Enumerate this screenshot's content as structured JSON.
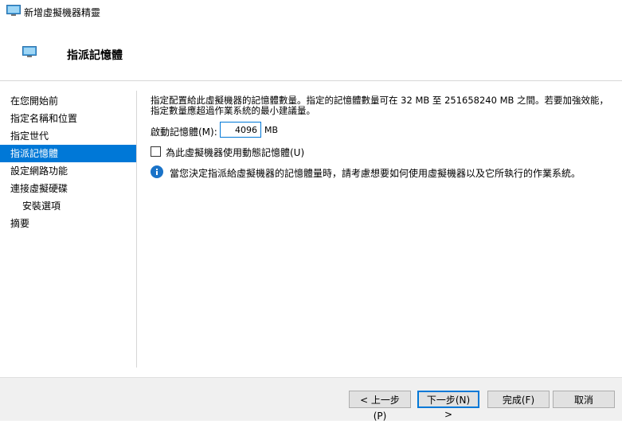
{
  "window": {
    "title": "新增虛擬機器精靈"
  },
  "header": {
    "heading": "指派記憶體"
  },
  "sidebar": {
    "items": [
      {
        "label": "在您開始前"
      },
      {
        "label": "指定名稱和位置"
      },
      {
        "label": "指定世代"
      },
      {
        "label": "指派記憶體"
      },
      {
        "label": "設定網路功能"
      },
      {
        "label": "連接虛擬硬碟"
      },
      {
        "label": "安裝選項"
      },
      {
        "label": "摘要"
      }
    ],
    "active_index": 3
  },
  "main": {
    "description_line1": "指定配置給此虛擬機器的記憶體數量。指定的記憶體數量可在 32 MB 至 251658240 MB 之間。若要加強效能，",
    "description_line2": "指定數量應超過作業系統的最小建議量。",
    "startup_memory_label": "啟動記憶體(M):",
    "startup_memory_value": "4096",
    "startup_memory_unit": "MB",
    "dynamic_memory_label": "為此虛擬機器使用動態記憶體(U)",
    "dynamic_memory_checked": false,
    "info_text": "當您決定指派給虛擬機器的記憶體量時，請考慮想要如何使用虛擬機器以及它所執行的作業系統。"
  },
  "buttons": {
    "previous": "< 上一步(P)",
    "next": "下一步(N) >",
    "finish": "完成(F)",
    "cancel": "取消"
  },
  "colors": {
    "accent": "#0078d7",
    "footer_bg": "#f0f0f0",
    "info_icon": "#1a73c8"
  }
}
